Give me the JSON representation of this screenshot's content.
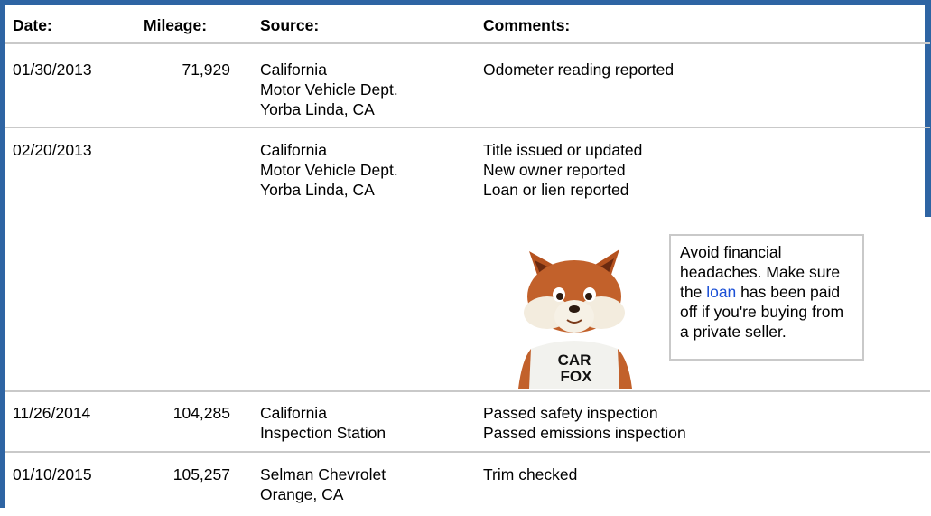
{
  "headers": {
    "date": "Date:",
    "mileage": "Mileage:",
    "source": "Source:",
    "comments": "Comments:"
  },
  "rows": [
    {
      "date": "01/30/2013",
      "mileage": "71,929",
      "source": [
        "California",
        "Motor Vehicle Dept.",
        "Yorba Linda, CA"
      ],
      "comments": [
        "Odometer reading reported"
      ]
    },
    {
      "date": "02/20/2013",
      "mileage": "",
      "source": [
        "California",
        "Motor Vehicle Dept.",
        "Yorba Linda, CA"
      ],
      "comments": [
        "Title issued or updated",
        "New owner reported",
        "Loan or lien reported"
      ]
    },
    {
      "date": "11/26/2014",
      "mileage": "104,285",
      "source": [
        "California",
        "Inspection Station"
      ],
      "comments": [
        "Passed safety inspection",
        "Passed emissions inspection"
      ]
    },
    {
      "date": "01/10/2015",
      "mileage": "105,257",
      "source": [
        "Selman Chevrolet",
        "Orange, CA"
      ],
      "comments": [
        "Trim checked"
      ]
    }
  ],
  "tip": {
    "before": "Avoid financial headaches. Make sure the ",
    "link": "loan",
    "after": " has been paid off if you're buying from a private seller."
  },
  "fox_shirt": {
    "line1": "CAR",
    "line2": "FOX"
  },
  "colors": {
    "frame": "#2e64a3",
    "divider": "#c9c9c9",
    "link": "#1a4fd6"
  }
}
